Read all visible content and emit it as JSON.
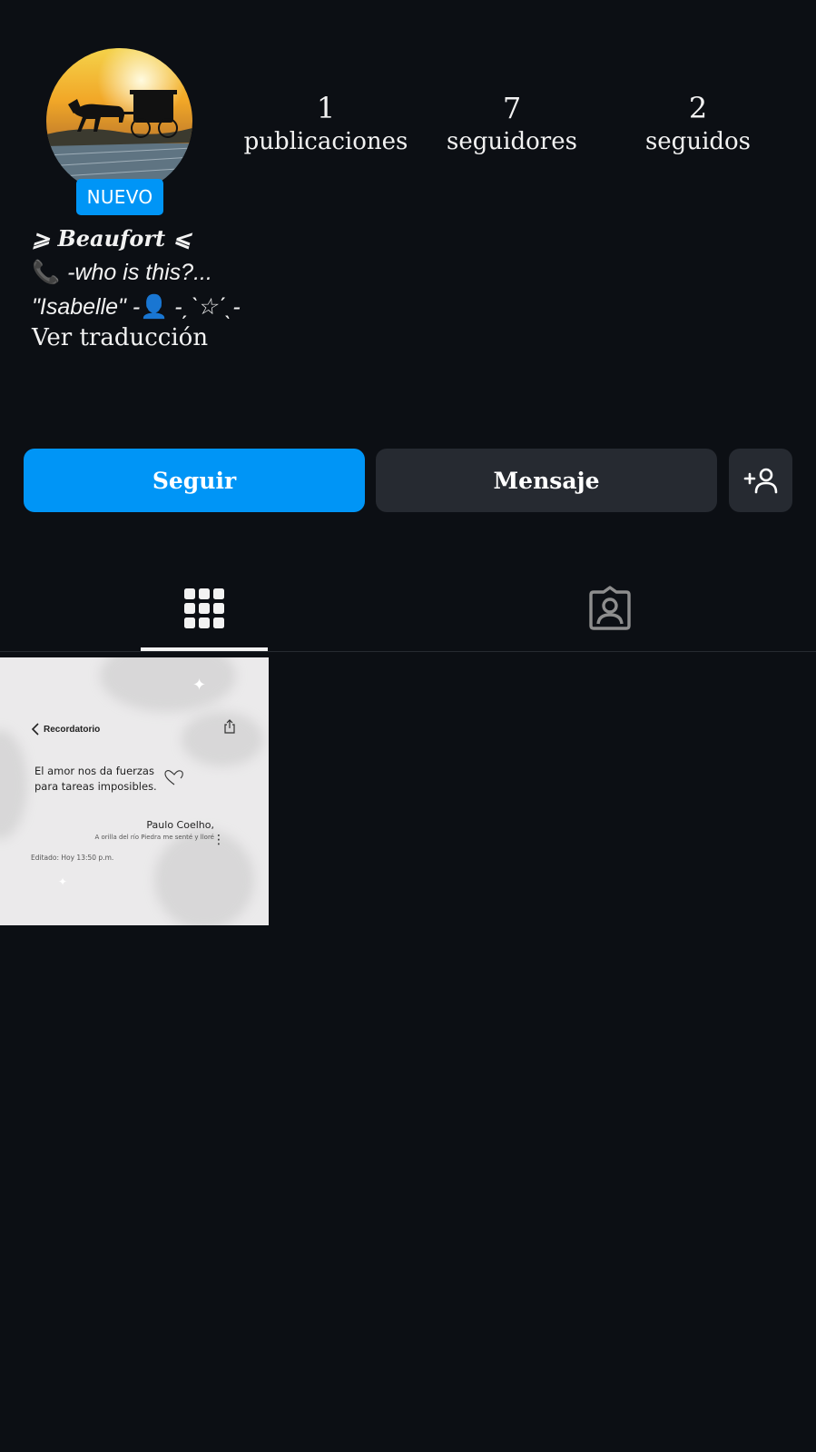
{
  "profile": {
    "badge": "NUEVO",
    "name": "⩾ 𝑩𝒆𝒂𝒖𝒇𝒐𝒓𝒕 ⩽",
    "bio_line1_icon": "📞",
    "bio_line1": "-who is this?...",
    "bio_line2_prefix": "\"Isabelle\" -",
    "bio_line2_icon": "👤",
    "bio_line2_suffix": " -ˏˋ☆ˊˎ-",
    "translate": "Ver traducción"
  },
  "stats": [
    {
      "value": "1",
      "label": "publicaciones"
    },
    {
      "value": "7",
      "label": "seguidores"
    },
    {
      "value": "2",
      "label": "seguidos"
    }
  ],
  "actions": {
    "follow": "Seguir",
    "message": "Mensaje",
    "add_icon": "add-person-icon"
  },
  "tabs": [
    {
      "icon": "grid-icon",
      "active": true
    },
    {
      "icon": "tagged-person-icon",
      "active": false
    }
  ],
  "post": {
    "header": "Recordatorio",
    "quote_line1": "El amor nos da fuerzas",
    "quote_line2": "para tareas imposibles.",
    "author": "Paulo Coelho,",
    "book": "A orilla del río Piedra me senté y lloré",
    "edited": "Editado: Hoy 13:50 p.m."
  },
  "colors": {
    "background": "#0c0f14",
    "accent": "#0095f6",
    "secondary_button": "#262a31"
  }
}
